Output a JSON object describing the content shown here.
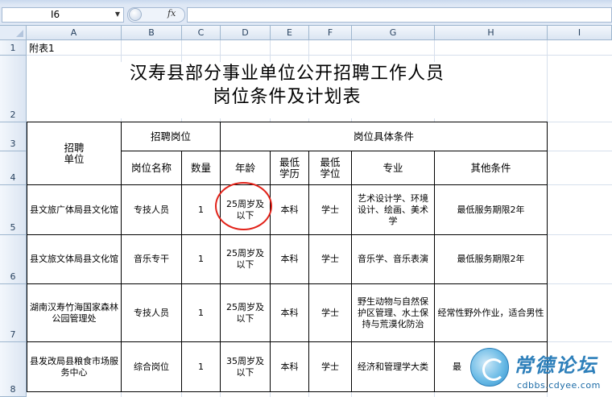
{
  "formula_bar": {
    "cell_ref": "I6",
    "fx": "fx",
    "formula": ""
  },
  "columns": [
    "A",
    "B",
    "C",
    "D",
    "E",
    "F",
    "G",
    "H",
    "I"
  ],
  "rows": [
    "1",
    "2",
    "3",
    "4",
    "5",
    "6",
    "7",
    "8"
  ],
  "sheet": {
    "attachment": "附表1",
    "title_line1": "汉寿县部分事业单位公开招聘工作人员",
    "title_line2": "岗位条件及计划表",
    "headers": {
      "unit": "招聘\n单位",
      "post_group": "招聘岗位",
      "conditions_group": "岗位具体条件",
      "post_name": "岗位名称",
      "quantity": "数量",
      "age": "年龄",
      "education": "最低\n学历",
      "degree": "最低\n学位",
      "major": "专业",
      "other": "其他条件"
    },
    "records": [
      {
        "unit": "县文旅广体局县文化馆",
        "post": "专技人员",
        "qty": "1",
        "age": "25周岁及以下",
        "edu": "本科",
        "degree": "学士",
        "major": "艺术设计学、环境设计、绘画、美术学",
        "other": "最低服务期限2年"
      },
      {
        "unit": "县文旅文体局县文化馆",
        "post": "音乐专干",
        "qty": "1",
        "age": "25周岁及以下",
        "edu": "本科",
        "degree": "学士",
        "major": "音乐学、音乐表演",
        "other": "最低服务期限2年"
      },
      {
        "unit": "湖南汉寿竹海国家森林公园管理处",
        "post": "专技人员",
        "qty": "1",
        "age": "25周岁及以下",
        "edu": "本科",
        "degree": "学士",
        "major": "野生动物与自然保护区管理、水土保持与荒漠化防治",
        "other": "经常性野外作业，适合男性"
      },
      {
        "unit": "县发改局县粮食市场服务中心",
        "post": "综合岗位",
        "qty": "1",
        "age": "35周岁及以下",
        "edu": "本科",
        "degree": "学士",
        "major": "经济和管理学大类",
        "other": "最"
      }
    ]
  },
  "watermark": {
    "title": "常德论坛",
    "url": "cdbbs.cdyee.com"
  },
  "colors": {
    "header_bg": "#dfe8f5",
    "grid_line": "#d6dfec",
    "annotation_circle": "#e2231a",
    "watermark": "#2d7fba"
  }
}
